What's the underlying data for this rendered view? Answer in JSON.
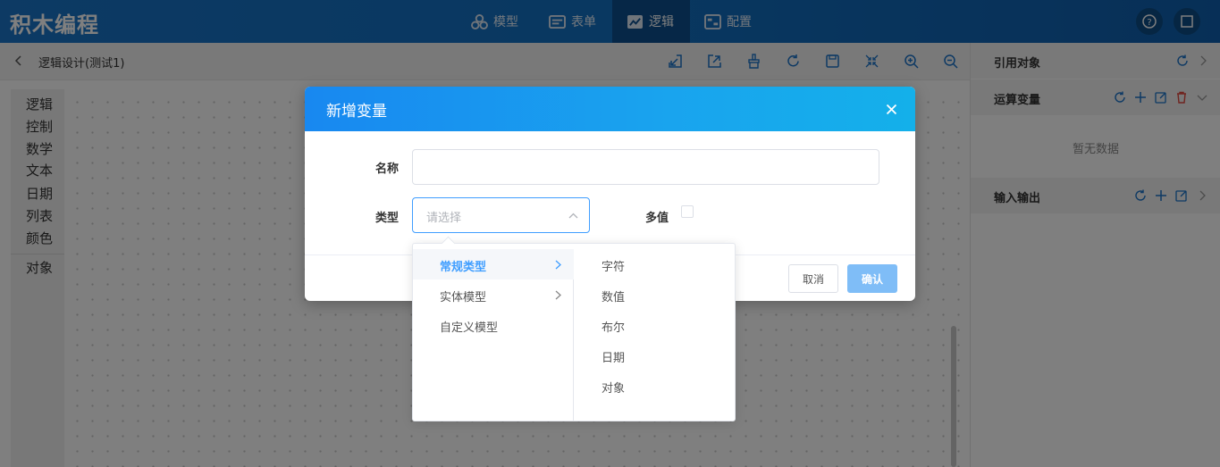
{
  "app": {
    "brand": "积木编程"
  },
  "nav": {
    "items": [
      {
        "label": "模型",
        "icon": "cubes-icon"
      },
      {
        "label": "表单",
        "icon": "form-icon"
      },
      {
        "label": "逻辑",
        "icon": "logic-icon",
        "active": true
      },
      {
        "label": "配置",
        "icon": "config-icon"
      }
    ],
    "help_icon": "help-icon",
    "fullscreen_icon": "square-icon"
  },
  "toolbar": {
    "breadcrumb": "逻辑设计(测试1)",
    "tools": [
      "import-icon",
      "export-icon",
      "clear-icon",
      "refresh-icon",
      "save-icon",
      "collapse-icon",
      "zoom-in-icon",
      "zoom-out-icon"
    ]
  },
  "categories": [
    "逻辑",
    "控制",
    "数学",
    "文本",
    "日期",
    "列表",
    "颜色",
    "对象"
  ],
  "right_panel": {
    "ref_objects": "引用对象",
    "op_vars": "运算变量",
    "no_data": "暂无数据",
    "io": "输入输出"
  },
  "dialog": {
    "title": "新增变量",
    "name_label": "名称",
    "name_value": "",
    "type_label": "类型",
    "type_placeholder": "请选择",
    "multi_label": "多值",
    "multi_checked": false,
    "cancel": "取消",
    "confirm": "确认"
  },
  "cascader": {
    "level1": [
      {
        "label": "常规类型",
        "has_children": true,
        "active": true
      },
      {
        "label": "实体模型",
        "has_children": true,
        "active": false
      },
      {
        "label": "自定义模型",
        "has_children": false,
        "active": false
      }
    ],
    "level2": [
      "字符",
      "数值",
      "布尔",
      "日期",
      "对象"
    ]
  },
  "colors": {
    "primary": "#409eff",
    "header": "#1270c2",
    "delete": "#e0483e"
  }
}
